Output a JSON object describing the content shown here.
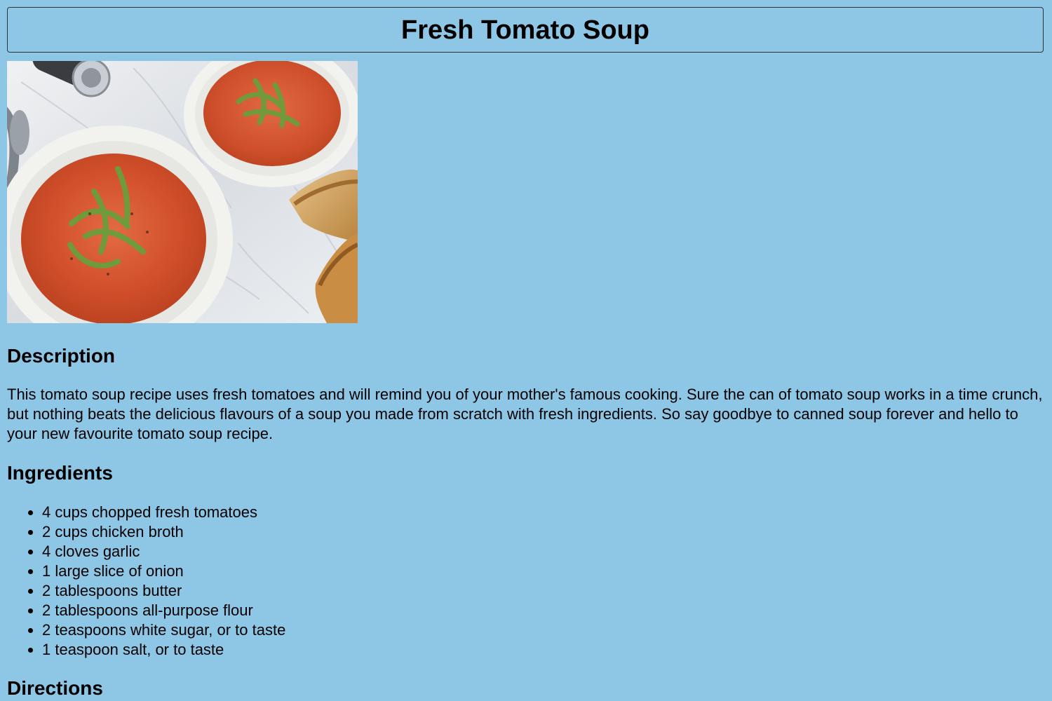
{
  "header": {
    "title": "Fresh Tomato Soup"
  },
  "hero": {
    "alt": "Fresh Tomato Soup"
  },
  "description": {
    "heading": "Description",
    "text": "This tomato soup recipe uses fresh tomatoes and will remind you of your mother's famous cooking. Sure the can of tomato soup works in a time crunch, but nothing beats the delicious flavours of a soup you made from scratch with fresh ingredients. So say goodbye to canned soup forever and hello to your new favourite tomato soup recipe."
  },
  "ingredients": {
    "heading": "Ingredients",
    "items": [
      "4 cups chopped fresh tomatoes",
      "2 cups chicken broth",
      "4 cloves garlic",
      "1 large slice of onion",
      "2 tablespoons butter",
      "2 tablespoons all-purpose flour",
      "2 teaspoons white sugar, or to taste",
      "1 teaspoon salt, or to taste"
    ]
  },
  "directions": {
    "heading": "Directions"
  },
  "colors": {
    "background": "#8ec6e6",
    "soup": "#d9532f",
    "bowl": "#f5f5f2",
    "marble": "#e7e8ea",
    "basil": "#6f9b3a",
    "bread": "#d7a55e"
  }
}
